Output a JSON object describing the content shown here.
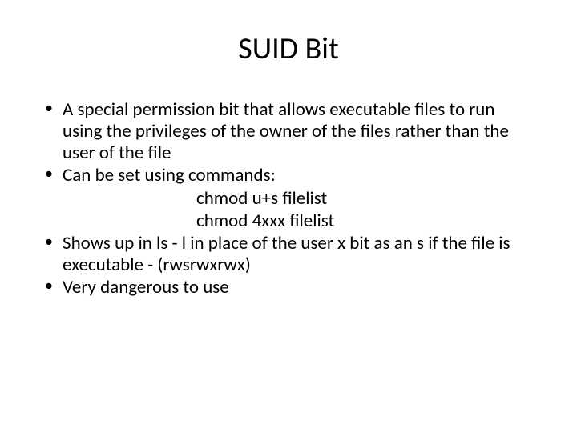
{
  "slide": {
    "title": "SUID Bit",
    "bullets": [
      {
        "text": "A special permission bit that allows executable files to run using the privileges of the owner of the files rather than the user of the file"
      },
      {
        "text": "Can be set using commands:",
        "sublines": [
          "chmod  u+s  filelist",
          "chmod  4xxx filelist"
        ]
      },
      {
        "text": " Shows up in ls - l in place of the user x bit as an s if the file is executable  -   (rwsrwxrwx)"
      },
      {
        "text": "Very dangerous to use"
      }
    ]
  }
}
